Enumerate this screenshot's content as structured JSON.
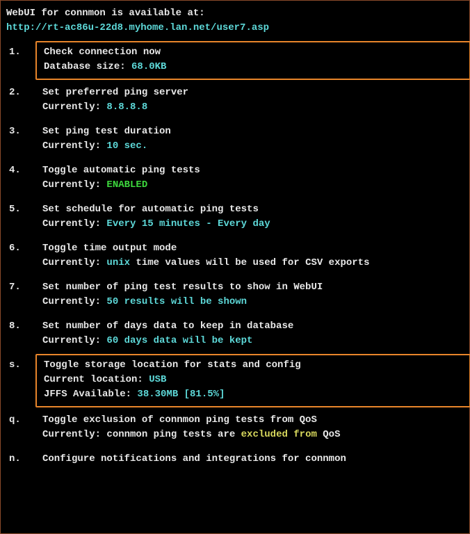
{
  "header": {
    "intro": "WebUI for connmon is available at:",
    "url": "http://rt-ac86u-22d8.myhome.lan.net/user7.asp"
  },
  "items": [
    {
      "num": "1.",
      "boxed": true,
      "l1": "Check connection now",
      "l2_prefix": "Database size: ",
      "l2_value": "68.0KB",
      "l2_suffix": "",
      "value_class": "cyan"
    },
    {
      "num": "2.",
      "boxed": false,
      "l1": "Set preferred ping server",
      "l2_prefix": "Currently: ",
      "l2_value": "8.8.8.8",
      "l2_suffix": "",
      "value_class": "cyan"
    },
    {
      "num": "3.",
      "boxed": false,
      "l1": "Set ping test duration",
      "l2_prefix": "Currently: ",
      "l2_value": "10 sec.",
      "l2_suffix": "",
      "value_class": "cyan"
    },
    {
      "num": "4.",
      "boxed": false,
      "l1": "Toggle automatic ping tests",
      "l2_prefix": "Currently: ",
      "l2_value": "ENABLED",
      "l2_suffix": "",
      "value_class": "green"
    },
    {
      "num": "5.",
      "boxed": false,
      "l1": "Set schedule for automatic ping tests",
      "l2_prefix": "Currently: ",
      "l2_value": "Every 15 minutes - Every day",
      "l2_suffix": "",
      "value_class": "cyan"
    },
    {
      "num": "6.",
      "boxed": false,
      "l1": "Toggle time output mode",
      "l2_prefix": "Currently: ",
      "l2_value": "unix",
      "l2_suffix": " time values will be used for CSV exports",
      "value_class": "cyan"
    },
    {
      "num": "7.",
      "boxed": false,
      "l1": "Set number of ping test results to show in WebUI",
      "l2_prefix": "Currently: ",
      "l2_value": "50 results will be shown",
      "l2_suffix": "",
      "value_class": "cyan"
    },
    {
      "num": "8.",
      "boxed": false,
      "l1": "Set number of days data to keep in database",
      "l2_prefix": "Currently: ",
      "l2_value": "60 days data will be kept",
      "l2_suffix": "",
      "value_class": "cyan"
    },
    {
      "num": "s.",
      "boxed": true,
      "l1": "Toggle storage location for stats and config",
      "l2a_prefix": "Current location: ",
      "l2a_value": "USB",
      "l2b_prefix": "JFFS Available: ",
      "l2b_value": "38.30MB [81.5%]",
      "value_class": "cyan",
      "three_lines": true
    },
    {
      "num": "q.",
      "boxed": false,
      "l1": "Toggle exclusion of connmon ping tests from QoS",
      "l2_prefix": "Currently: connmon ping tests are ",
      "l2_value": "excluded from",
      "l2_suffix": " QoS",
      "value_class": "yellow"
    },
    {
      "num": "n.",
      "boxed": false,
      "l1": "Configure notifications and integrations for connmon",
      "single_line": true
    }
  ]
}
